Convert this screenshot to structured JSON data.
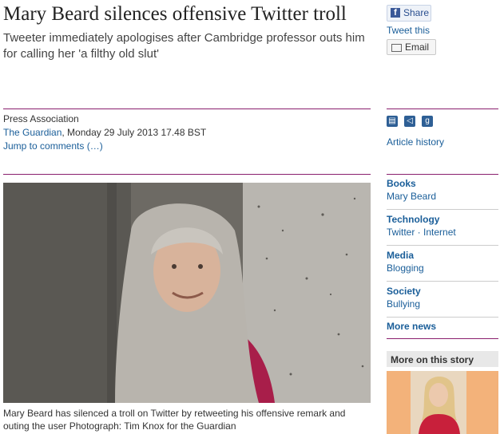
{
  "article": {
    "headline": "Mary Beard silences offensive Twitter troll",
    "standfirst": "Tweeter immediately apologises after Cambridge professor outs him for calling her 'a filthy old slut'",
    "byline_source": "Press Association",
    "byline_paper": "The Guardian",
    "byline_date": ", Monday 29 July 2013 17.48 BST",
    "jump_link": "Jump to comments (…)",
    "caption": "Mary Beard has silenced a troll on Twitter by retweeting his offensive remark and outing the user Photograph: Tim Knox for the Guardian"
  },
  "share": {
    "facebook_label": "Share",
    "tweet_label": "Tweet this",
    "email_label": "Email"
  },
  "sidebar": {
    "article_history": "Article history",
    "categories": [
      {
        "heading": "Books",
        "sub": "Mary Beard"
      },
      {
        "heading": "Technology",
        "sub": "Twitter · Internet"
      },
      {
        "heading": "Media",
        "sub": "Blogging"
      },
      {
        "heading": "Society",
        "sub": "Bullying"
      }
    ],
    "more_news": "More news",
    "more_on_story": "More on this story"
  },
  "colors": {
    "accent": "#8a1f6d",
    "link": "#1a5e99"
  }
}
